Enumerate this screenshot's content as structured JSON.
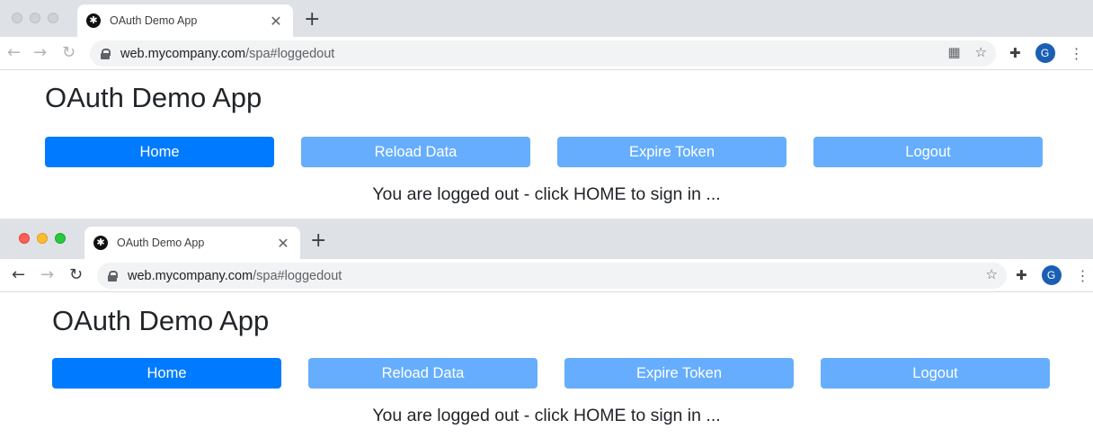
{
  "windows": [
    {
      "tab": {
        "title": "OAuth Demo App",
        "close": "✕",
        "new_tab": "+"
      },
      "toolbar": {
        "back": "←",
        "forward": "→",
        "reload": "↻",
        "url_host": "web.mycompany.com",
        "url_path": "/spa#loggedout",
        "omnibox_icons": [
          "qr-code-icon",
          "star-icon"
        ],
        "extensions_icon": "puzzle-icon",
        "avatar_letter": "G",
        "menu": "⋮"
      },
      "page": {
        "title": "OAuth Demo App",
        "buttons": {
          "home": "Home",
          "reload": "Reload Data",
          "expire": "Expire Token",
          "logout": "Logout"
        },
        "status": "You are logged out - click HOME to sign in ..."
      }
    },
    {
      "tab": {
        "title": "OAuth Demo App",
        "close": "✕",
        "new_tab": "+"
      },
      "toolbar": {
        "back": "←",
        "forward": "→",
        "reload": "↻",
        "url_host": "web.mycompany.com",
        "url_path": "/spa#loggedout",
        "omnibox_icons": [
          "star-icon"
        ],
        "extensions_icon": "puzzle-icon",
        "avatar_letter": "G",
        "menu": "⋮"
      },
      "page": {
        "title": "OAuth Demo App",
        "buttons": {
          "home": "Home",
          "reload": "Reload Data",
          "expire": "Expire Token",
          "logout": "Logout"
        },
        "status": "You are logged out - click HOME to sign in ..."
      }
    }
  ],
  "colors": {
    "primary_button": "#007bff",
    "disabled_button": "#66aefd",
    "tabstrip": "#dee1e6",
    "omnibox": "#f1f3f4",
    "avatar": "#1a5fb4"
  }
}
